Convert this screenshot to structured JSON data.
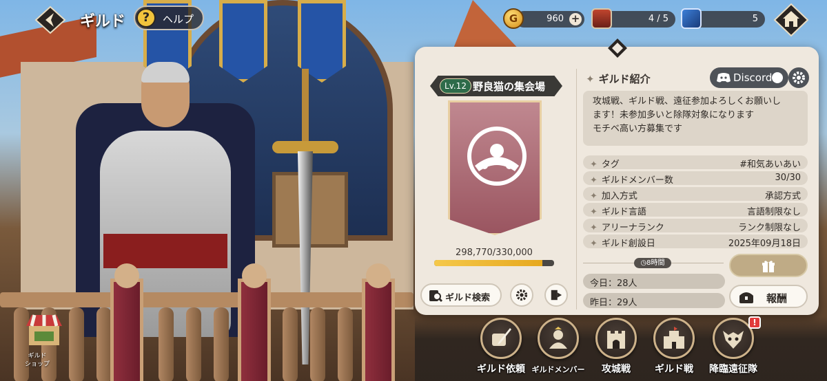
{
  "header": {
    "title": "ギルド",
    "help_label": "ヘルプ"
  },
  "resources": {
    "gold": "960",
    "gold_icon_glyph": "G",
    "stamina": "4 / 5",
    "tickets": "5"
  },
  "guild": {
    "level": "Lv.12",
    "name": "野良猫の集会場",
    "exp_text": "298,770/330,000",
    "exp_fraction": 0.905
  },
  "buttons": {
    "search_label": "ギルド検索",
    "discord_label": "Discord",
    "reward_label": "報酬"
  },
  "intro": {
    "title": "ギルド紹介",
    "lines": [
      "攻城戦、ギルド戦、遠征参加よろしくお願いし",
      "ます！未参加多いと除隊対象になります",
      "モチベ高い方募集です"
    ]
  },
  "info": [
    {
      "key": "タグ",
      "value": "#和気あいあい"
    },
    {
      "key": "ギルドメンバー数",
      "value": "30/30"
    },
    {
      "key": "加入方式",
      "value": "承認方式"
    },
    {
      "key": "ギルド言語",
      "value": "言語制限なし"
    },
    {
      "key": "アリーナランク",
      "value": "ランク制限なし"
    },
    {
      "key": "ギルド創設日",
      "value": "2025年09月18日"
    }
  ],
  "activity": {
    "timer": "8時間",
    "today": "今日：28人",
    "yesterday": "昨日：29人"
  },
  "nav": [
    {
      "label": "ギルド依頼",
      "icon": "scroll-quill-icon"
    },
    {
      "label": "ギルドメンバー",
      "icon": "member-icon"
    },
    {
      "label": "攻城戦",
      "icon": "castle-gate-icon"
    },
    {
      "label": "ギルド戦",
      "icon": "fortress-icon"
    },
    {
      "label": "降臨遠征隊",
      "icon": "beast-skull-icon"
    }
  ],
  "alert_badge": "!",
  "shop": {
    "line1": "ギルド",
    "line2": "ショップ"
  },
  "colors": {
    "panel": "#efe8de",
    "exp_fill": "#f5c84a",
    "alert": "#e23a3a",
    "discord": "#4e5258"
  }
}
